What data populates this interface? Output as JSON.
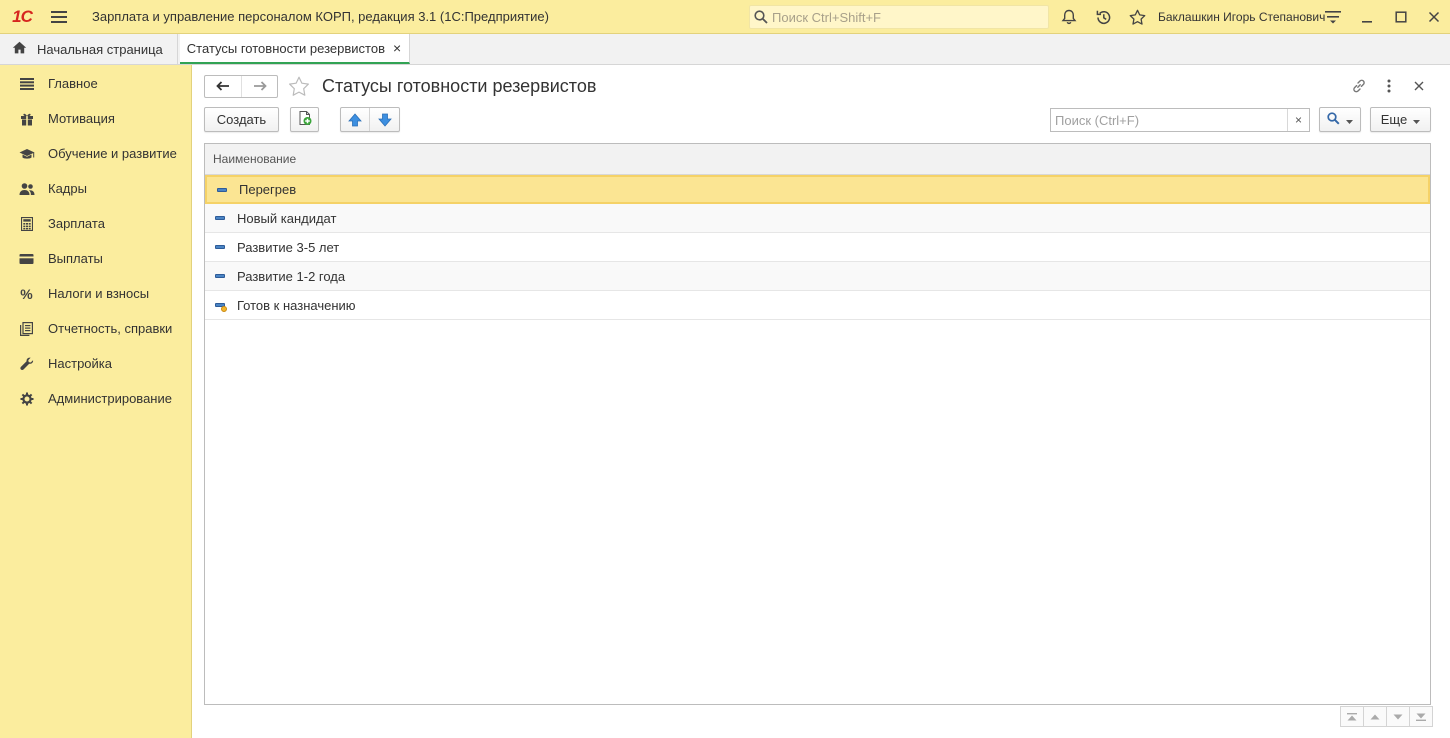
{
  "titlebar": {
    "logo": "1С",
    "app_title": "Зарплата и управление персоналом КОРП, редакция 3.1  (1С:Предприятие)",
    "search_placeholder": "Поиск Ctrl+Shift+F",
    "username": "Баклашкин Игорь Степанович"
  },
  "tabs": {
    "home_label": "Начальная страница",
    "active_label": "Статусы готовности резервистов",
    "close_glyph": "×"
  },
  "sidebar": {
    "items": [
      {
        "label": "Главное",
        "icon": "menu-lines-icon"
      },
      {
        "label": "Мотивация",
        "icon": "gift-icon"
      },
      {
        "label": "Обучение и развитие",
        "icon": "graduation-cap-icon"
      },
      {
        "label": "Кадры",
        "icon": "people-icon"
      },
      {
        "label": "Зарплата",
        "icon": "calculator-icon"
      },
      {
        "label": "Выплаты",
        "icon": "wallet-icon"
      },
      {
        "label": "Налоги и взносы",
        "icon": "percent-icon"
      },
      {
        "label": "Отчетность, справки",
        "icon": "reports-icon"
      },
      {
        "label": "Настройка",
        "icon": "wrench-icon"
      },
      {
        "label": "Администрирование",
        "icon": "gear-icon"
      }
    ]
  },
  "form": {
    "title": "Статусы готовности резервистов",
    "create_label": "Создать",
    "search_placeholder": "Поиск (Ctrl+F)",
    "clear_glyph": "×",
    "more_label": "Еще"
  },
  "table": {
    "column_header": "Наименование",
    "rows": [
      {
        "name": "Перегрев",
        "icon": "item-icon"
      },
      {
        "name": "Новый кандидат",
        "icon": "item-icon"
      },
      {
        "name": "Развитие 3-5 лет",
        "icon": "item-icon"
      },
      {
        "name": "Развитие 1-2 года",
        "icon": "item-icon"
      },
      {
        "name": "Готов к назначению",
        "icon": "item-predefined-icon"
      }
    ],
    "selected_row": 0
  },
  "colors": {
    "accent_yellow": "#fbed9e",
    "selected_row": "#fbe593",
    "active_tab_underline": "#31a354",
    "brand_red": "#d6261f"
  }
}
